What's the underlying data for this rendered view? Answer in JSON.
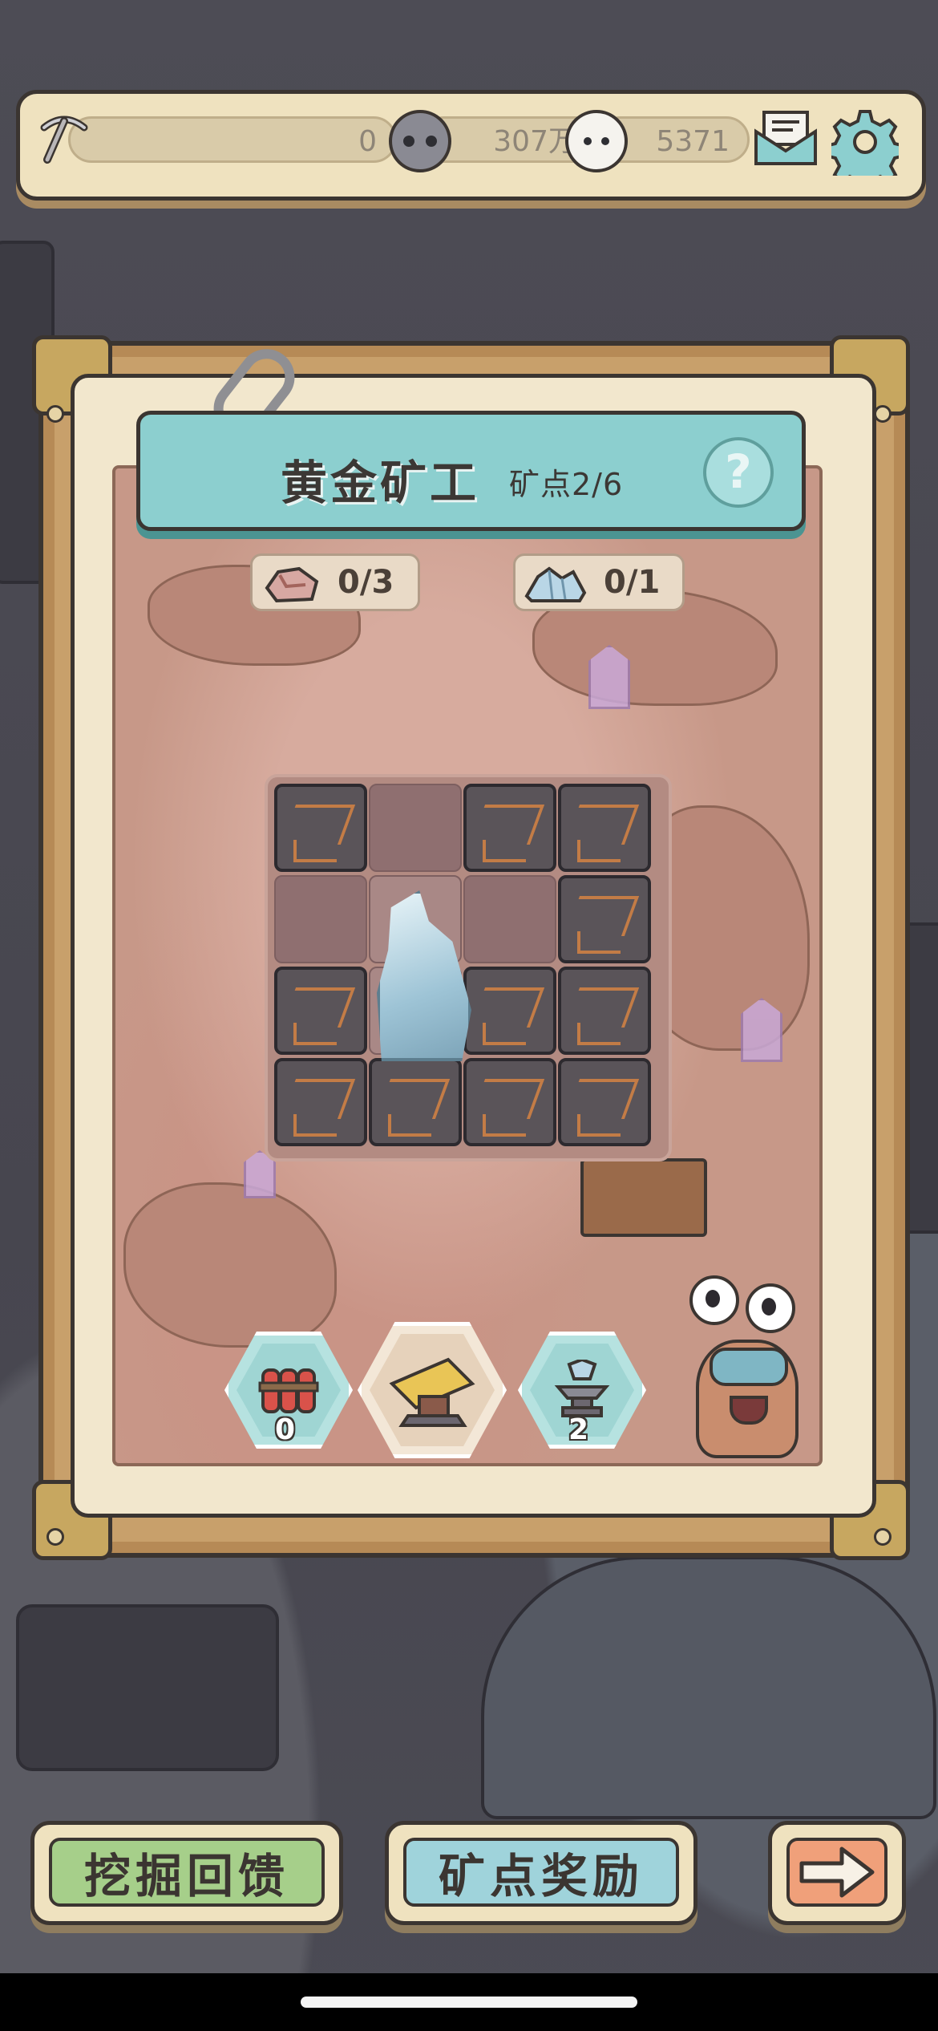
{
  "topbar": {
    "pickaxe_count": "0",
    "ghost_currency": "307万",
    "bubble_currency": "5371",
    "icons": [
      "pickaxe-icon",
      "ghost-coin-icon",
      "ghost-bubble-icon",
      "mail-icon",
      "gear-icon"
    ]
  },
  "panel": {
    "title": "黄金矿工",
    "subtitle": "矿点2/6",
    "help_label": "?",
    "ore_counter": "0/3",
    "crystal_counter": "0/1"
  },
  "grid": {
    "rows": 4,
    "cols": 4,
    "cells": [
      [
        "rock",
        "open",
        "rock",
        "rock"
      ],
      [
        "open",
        "open-light",
        "open",
        "rock"
      ],
      [
        "rock",
        "open-light",
        "rock",
        "rock"
      ],
      [
        "rock",
        "rock",
        "rock",
        "rock"
      ]
    ]
  },
  "tools": {
    "dynamite_count": "0",
    "drill_count": "",
    "crystal_anvil_count": "2"
  },
  "buttons": {
    "dig_feedback": "挖掘回馈",
    "mine_rewards": "矿点奖励",
    "next_icon": "arrow-right-icon"
  },
  "colors": {
    "teal_banner": "#8ccfcf",
    "green_button": "#a6cf8a",
    "blue_button": "#9fd3db",
    "orange_button": "#f0a07a",
    "rock_vein": "#c37c46"
  }
}
